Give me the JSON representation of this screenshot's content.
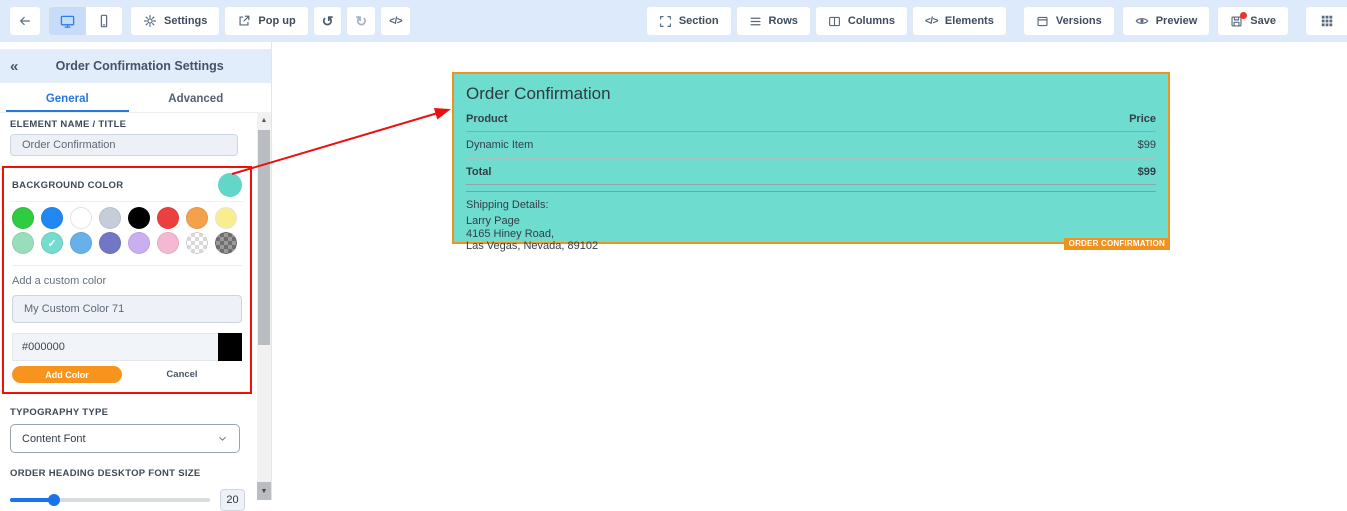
{
  "toolbar": {
    "back_icon": "arrow-left",
    "settings_label": "Settings",
    "popup_label": "Pop up",
    "undo_icon": "↺",
    "redo_icon": "↻",
    "code_icon": "</>",
    "section_label": "Section",
    "rows_label": "Rows",
    "columns_label": "Columns",
    "elements_label": "Elements",
    "elements_icon": "</>",
    "versions_label": "Versions",
    "preview_label": "Preview",
    "save_label": "Save"
  },
  "sidebar": {
    "collapse_icon": "«",
    "title": "Order Confirmation Settings",
    "tabs": [
      {
        "label": "General",
        "active": true
      },
      {
        "label": "Advanced",
        "active": false
      }
    ],
    "element_name": {
      "label": "ELEMENT NAME / TITLE",
      "value": "Order Confirmation"
    },
    "background_color": {
      "label": "BACKGROUND COLOR",
      "current_color": "#63d5c9",
      "swatches": [
        {
          "color": "#2fcb41"
        },
        {
          "color": "#2187f2"
        },
        {
          "color": "#ffffff",
          "light_border": true
        },
        {
          "color": "#c4cdd9"
        },
        {
          "color": "#000000"
        },
        {
          "color": "#ec4040"
        },
        {
          "color": "#f4a14b"
        },
        {
          "color": "#f8ee90",
          "light_border": true
        },
        {
          "color": "#99debb"
        },
        {
          "color": "#74dccf",
          "selected": true
        },
        {
          "color": "#66b1ea"
        },
        {
          "color": "#7277c5"
        },
        {
          "color": "#c9aef2"
        },
        {
          "color": "#f5b8d2"
        },
        {
          "pattern": "checker-light"
        },
        {
          "pattern": "checker-dark"
        }
      ],
      "check_icon": "✓"
    },
    "custom_color": {
      "label": "Add a custom color",
      "name_value": "My Custom Color 71",
      "hex_value": "#000000",
      "swatch_color": "#000000",
      "add_label": "Add Color",
      "cancel_label": "Cancel"
    },
    "typography": {
      "label": "TYPOGRAPHY TYPE",
      "value": "Content Font"
    },
    "heading_font_size": {
      "label": "ORDER HEADING DESKTOP FONT SIZE",
      "value": "20"
    }
  },
  "canvas": {
    "order_box": {
      "title": "Order Confirmation",
      "bg_color": "#6edccf",
      "border_color": "#f0921e",
      "columns": {
        "product": "Product",
        "price": "Price"
      },
      "rows": [
        {
          "name": "Dynamic Item",
          "price": "$99"
        }
      ],
      "total": {
        "label": "Total",
        "price": "$99"
      },
      "shipping": {
        "heading": "Shipping Details:",
        "lines": [
          "Larry Page",
          "4165 Hiney Road,",
          "Las Vegas, Nevada, 89102"
        ]
      },
      "tag": "ORDER CONFIRMATION"
    }
  },
  "annotation": {
    "color": "#f01008"
  }
}
